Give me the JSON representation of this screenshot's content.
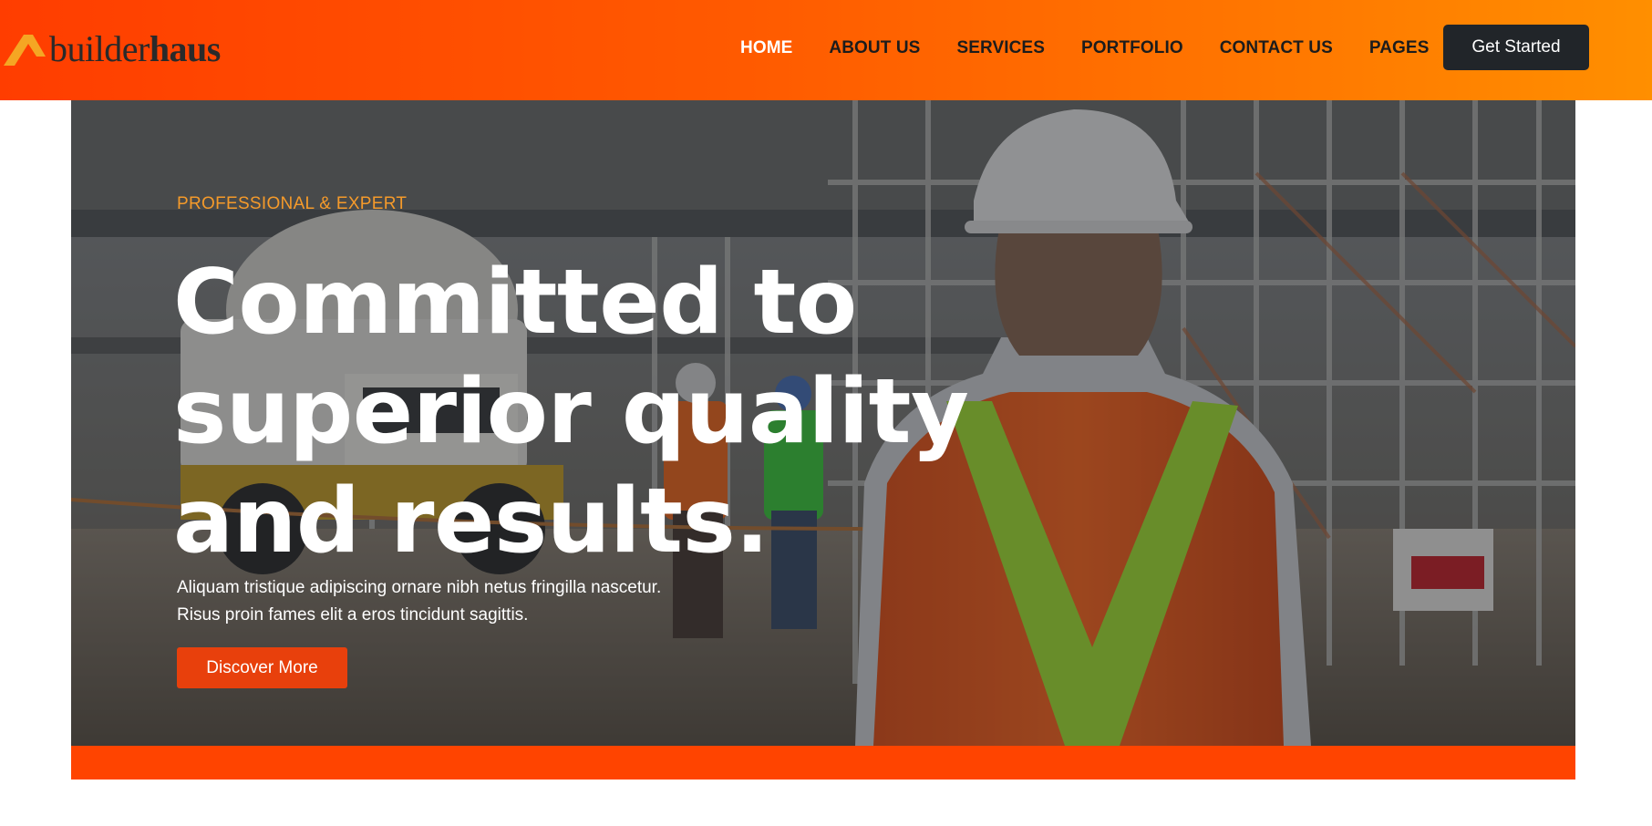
{
  "brand": {
    "name_part1": "builder",
    "name_part2": "haus",
    "logo_icon": "roof-chevron-icon",
    "logo_color": "#f5a623"
  },
  "nav": {
    "items": [
      {
        "label": "HOME",
        "active": true
      },
      {
        "label": "ABOUT US",
        "active": false
      },
      {
        "label": "SERVICES",
        "active": false
      },
      {
        "label": "PORTFOLIO",
        "active": false
      },
      {
        "label": "CONTACT US",
        "active": false
      },
      {
        "label": "PAGES",
        "active": false
      }
    ],
    "cta_label": "Get Started"
  },
  "hero": {
    "eyebrow": "PROFESSIONAL & EXPERT",
    "title_lines": [
      "Committed to",
      "superior quality",
      "and results."
    ],
    "subtitle_lines": [
      "Aliquam tristique adipiscing ornare nibh netus fringilla nascetur.",
      "Risus proin fames elit a eros tincidunt sagittis."
    ],
    "button_label": "Discover More",
    "background_image": "construction-worker-hardhat-safety-vest-site-photo"
  },
  "colors": {
    "header_gradient_start": "#ff3d00",
    "header_gradient_end": "#ff8f00",
    "accent": "#ff4400",
    "button_orange": "#e8400c",
    "eyebrow": "#f59a2a",
    "dark_button": "#212529"
  }
}
